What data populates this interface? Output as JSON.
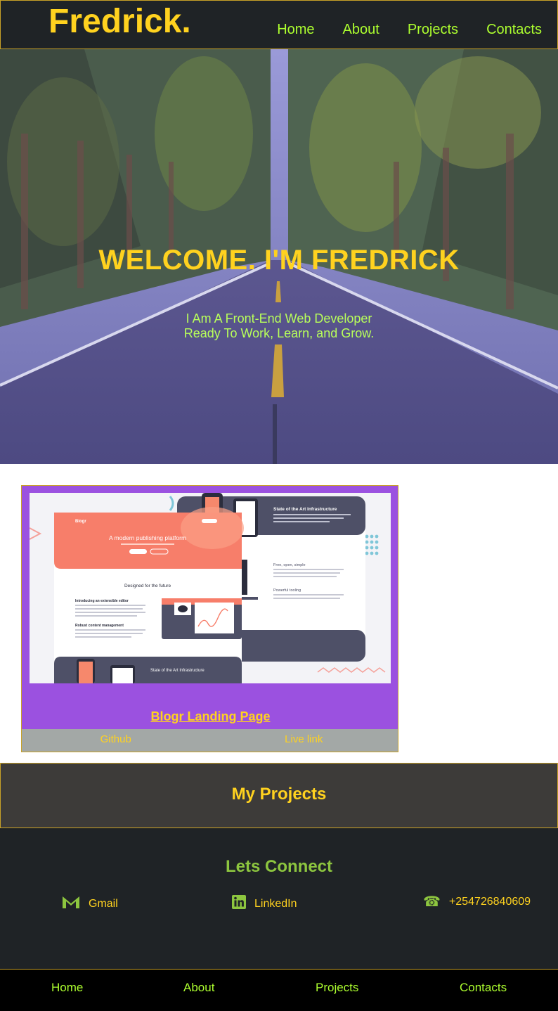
{
  "header": {
    "brand": "Fredrick.",
    "nav": [
      "Home",
      "About",
      "Projects",
      "Contacts"
    ]
  },
  "hero": {
    "title": "WELCOME. I'M FREDRICK",
    "subtitle_line1": "I Am A Front-End Web Developer",
    "subtitle_line2": "Ready To Work, Learn, and Grow."
  },
  "project": {
    "title": "Blogr Landing Page",
    "github_label": "Github",
    "live_label": "Live link",
    "screenshot": {
      "logo": "Blogr",
      "headline": "A modern publishing platform",
      "section_title": "Designed for the future",
      "infra_title": "State of the Art Infrastructure",
      "infra_title_bottom": "State of the Art Infrastructure",
      "free_title": "Free, open, simple",
      "powerful_title": "Powerful tooling",
      "intro_title": "Introducing an extensible editor",
      "robust_title": "Robust content management"
    }
  },
  "projects_section": {
    "title": "My Projects"
  },
  "connect": {
    "title": "Lets Connect",
    "gmail": "Gmail",
    "linkedin": "LinkedIn",
    "phone": "+254726840609"
  },
  "footer": {
    "nav": [
      "Home",
      "About",
      "Projects",
      "Contacts"
    ]
  },
  "colors": {
    "accent_yellow": "#ffd21f",
    "accent_green": "#adff2f",
    "card_purple": "#9b51e0",
    "dark_bg": "#1f2326"
  },
  "icons": {
    "gmail": "gmail-icon",
    "linkedin": "linkedin-icon",
    "phone": "phone-icon"
  }
}
